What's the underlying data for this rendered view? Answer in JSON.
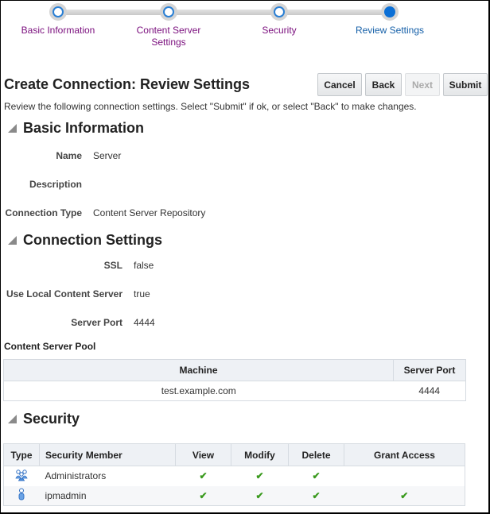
{
  "train": {
    "steps": [
      {
        "label": "Basic Information",
        "state": "visited"
      },
      {
        "label": "Content Server Settings",
        "state": "visited"
      },
      {
        "label": "Security",
        "state": "visited"
      },
      {
        "label": "Review Settings",
        "state": "current"
      }
    ]
  },
  "header": {
    "title": "Create Connection: Review Settings",
    "buttons": {
      "cancel": "Cancel",
      "back": "Back",
      "next": "Next",
      "submit": "Submit"
    },
    "instructions": "Review the following connection settings. Select \"Submit\" if ok, or select \"Back\" to make changes."
  },
  "basic": {
    "heading": "Basic Information",
    "fields": [
      {
        "label": "Name",
        "value": "Server"
      },
      {
        "label": "Description",
        "value": ""
      },
      {
        "label": "Connection Type",
        "value": "Content Server Repository"
      }
    ]
  },
  "connection": {
    "heading": "Connection Settings",
    "fields": [
      {
        "label": "SSL",
        "value": "false"
      },
      {
        "label": "Use Local Content Server",
        "value": "true"
      },
      {
        "label": "Server Port",
        "value": "4444"
      }
    ],
    "pool_label": "Content Server Pool",
    "pool_columns": [
      "Machine",
      "Server Port"
    ],
    "pool_rows": [
      {
        "machine": "test.example.com",
        "port": "4444"
      }
    ]
  },
  "security": {
    "heading": "Security",
    "columns": [
      "Type",
      "Security Member",
      "View",
      "Modify",
      "Delete",
      "Grant Access"
    ],
    "rows": [
      {
        "type_icon": "group-icon",
        "member": "Administrators",
        "view": "✔",
        "modify": "✔",
        "delete": "✔",
        "grant": ""
      },
      {
        "type_icon": "user-icon",
        "member": "ipmadmin",
        "view": "✔",
        "modify": "✔",
        "delete": "✔",
        "grant": "✔"
      }
    ]
  }
}
